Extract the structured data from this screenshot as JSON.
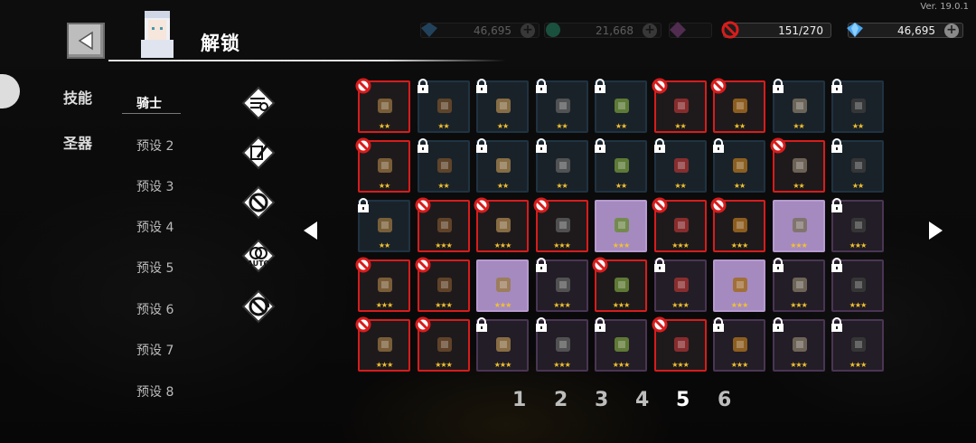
{
  "version": "Ver. 19.0.1",
  "title": "解锁",
  "resources": [
    {
      "name": "gems-faded",
      "value": "46,695"
    },
    {
      "name": "green-coins-faded",
      "value": "21,668"
    },
    {
      "name": "energy-faded",
      "value": ""
    },
    {
      "name": "unlock-count",
      "value": "151/270"
    },
    {
      "name": "gems",
      "value": "46,695"
    }
  ],
  "nav": {
    "skills": "技能",
    "relics": "圣器"
  },
  "presets": [
    "骑士",
    "预设 2",
    "预设 3",
    "预设 4",
    "预设 5",
    "预设 6",
    "预设 7",
    "预设 8"
  ],
  "tools": [
    "filter-icon",
    "edit-icon",
    "ban-icon",
    "auto-ban-icon",
    "auto-clear-icon"
  ],
  "auto_label": "AUTO",
  "grid": [
    [
      {
        "s": "red",
        "st": "★★",
        "icon": "stick"
      },
      {
        "s": "lock",
        "st": "★★",
        "icon": "bow"
      },
      {
        "s": "lock",
        "st": "★★",
        "icon": "shield"
      },
      {
        "s": "lock",
        "st": "★★",
        "icon": "wings"
      },
      {
        "s": "lock",
        "st": "★★",
        "icon": "pot"
      },
      {
        "s": "red",
        "st": "★★",
        "icon": "rune"
      },
      {
        "s": "red",
        "st": "★★",
        "icon": "spear"
      },
      {
        "s": "lock",
        "st": "★★",
        "icon": "gear"
      },
      {
        "s": "lock",
        "st": "★★",
        "icon": "staff"
      }
    ],
    [
      {
        "s": "red",
        "st": "★★",
        "icon": "paw"
      },
      {
        "s": "lock",
        "st": "★★",
        "icon": "blade"
      },
      {
        "s": "lock",
        "st": "★★",
        "icon": "book"
      },
      {
        "s": "lock",
        "st": "★★",
        "icon": "flask"
      },
      {
        "s": "lock",
        "st": "★★",
        "icon": "coin"
      },
      {
        "s": "lock",
        "st": "★★",
        "icon": "cube"
      },
      {
        "s": "lock",
        "st": "★★",
        "icon": "fish"
      },
      {
        "s": "red",
        "st": "★★",
        "icon": "branch"
      },
      {
        "s": "lock",
        "st": "★★",
        "icon": "meat"
      }
    ],
    [
      {
        "s": "lock",
        "st": "★★",
        "icon": "wand"
      },
      {
        "s": "red",
        "st": "★★★",
        "icon": "potion"
      },
      {
        "s": "red",
        "st": "★★★",
        "icon": "tome"
      },
      {
        "s": "red",
        "st": "★★★",
        "icon": "rock"
      },
      {
        "s": "hl",
        "st": "★★★",
        "icon": "dice"
      },
      {
        "s": "red",
        "st": "★★★",
        "icon": "cup"
      },
      {
        "s": "red",
        "st": "★★★",
        "icon": "scroll"
      },
      {
        "s": "hl",
        "st": "★★★",
        "icon": "brain"
      },
      {
        "s": "lockp",
        "st": "★★★",
        "icon": "syringe"
      }
    ],
    [
      {
        "s": "red",
        "st": "★★★",
        "icon": "orb"
      },
      {
        "s": "red",
        "st": "★★★",
        "icon": "crest"
      },
      {
        "s": "hl",
        "st": "★★★",
        "icon": "cross"
      },
      {
        "s": "lockp",
        "st": "★★★",
        "icon": "leaf"
      },
      {
        "s": "red",
        "st": "★★★",
        "icon": "bat"
      },
      {
        "s": "lockp",
        "st": "★★★",
        "icon": "sun"
      },
      {
        "s": "hl",
        "st": "★★★",
        "icon": "map"
      },
      {
        "s": "lockp",
        "st": "★★★",
        "icon": "chain"
      },
      {
        "s": "lockp",
        "st": "★★★",
        "icon": "flame"
      }
    ],
    [
      {
        "s": "red",
        "st": "★★★",
        "icon": "egg"
      },
      {
        "s": "red",
        "st": "★★★",
        "icon": "medkit"
      },
      {
        "s": "lockp",
        "st": "★★★",
        "icon": "mask"
      },
      {
        "s": "lockp",
        "st": "★★★",
        "icon": "feather"
      },
      {
        "s": "lockp",
        "st": "★★★",
        "icon": "moon"
      },
      {
        "s": "red",
        "st": "★★★",
        "icon": "sushi"
      },
      {
        "s": "lockp",
        "st": "★★★",
        "icon": "boot"
      },
      {
        "s": "lockp",
        "st": "★★★",
        "icon": "sword"
      },
      {
        "s": "lockp",
        "st": "★★★",
        "icon": "crystal"
      }
    ]
  ],
  "pages": [
    "1",
    "2",
    "3",
    "4",
    "5",
    "6"
  ],
  "active_page": "5",
  "colors": {
    "ban": "#d81c1c",
    "star": "#f0c030",
    "highlight": "#a58ac0",
    "accent": "#4aa6f0"
  }
}
